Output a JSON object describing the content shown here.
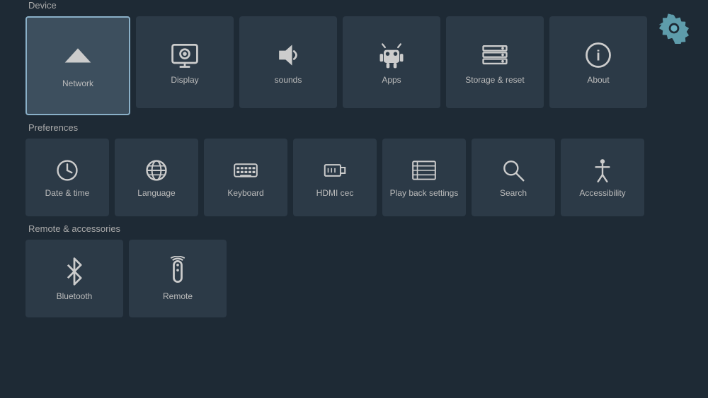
{
  "header": {
    "settings_icon_label": "settings"
  },
  "sections": {
    "device": {
      "label": "Device",
      "tiles": [
        {
          "id": "network",
          "label": "Network",
          "active": true
        },
        {
          "id": "display",
          "label": "Display",
          "active": false
        },
        {
          "id": "sounds",
          "label": "sounds",
          "active": false
        },
        {
          "id": "apps",
          "label": "Apps",
          "active": false
        },
        {
          "id": "storage-reset",
          "label": "Storage & reset",
          "active": false
        },
        {
          "id": "about",
          "label": "About",
          "active": false
        }
      ]
    },
    "preferences": {
      "label": "Preferences",
      "tiles": [
        {
          "id": "date-time",
          "label": "Date & time",
          "active": false
        },
        {
          "id": "language",
          "label": "Language",
          "active": false
        },
        {
          "id": "keyboard",
          "label": "Keyboard",
          "active": false
        },
        {
          "id": "hdmi-cec",
          "label": "HDMI cec",
          "active": false
        },
        {
          "id": "playback-settings",
          "label": "Play back settings",
          "active": false
        },
        {
          "id": "search",
          "label": "Search",
          "active": false
        },
        {
          "id": "accessibility",
          "label": "Accessibility",
          "active": false
        }
      ]
    },
    "remote": {
      "label": "Remote & accessories",
      "tiles": [
        {
          "id": "bluetooth",
          "label": "Bluetooth",
          "active": false
        },
        {
          "id": "remote",
          "label": "Remote",
          "active": false
        }
      ]
    }
  }
}
